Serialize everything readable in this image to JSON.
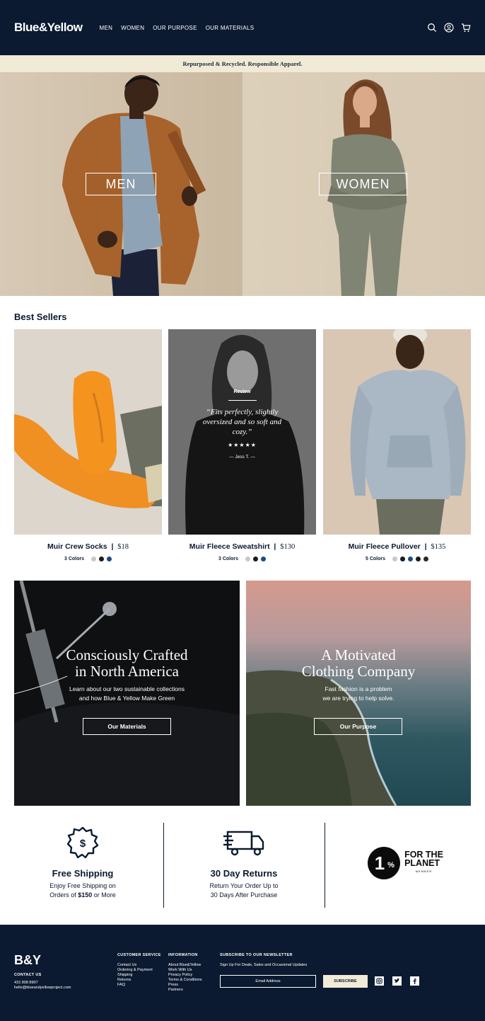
{
  "header": {
    "logo": "Blue&Yellow",
    "nav": [
      "MEN",
      "WOMEN",
      "OUR PURPOSE",
      "OUR MATERIALS"
    ],
    "icons": [
      "search-icon",
      "account-icon",
      "cart-icon"
    ]
  },
  "banner": {
    "text": "Repurposed & Recycled. Responsible Apparel."
  },
  "hero": {
    "men_label": "MEN",
    "women_label": "WOMEN"
  },
  "best_sellers": {
    "title": "Best Sellers",
    "review": {
      "label": "Review",
      "quote": "“Fits perfectly, slightly oversized and so soft and cozy.”",
      "stars": "★★★★★",
      "author": "— Jess T. —"
    },
    "products": [
      {
        "name": "Muir Crew Socks",
        "price": "$18",
        "colors_label": "3 Colors",
        "swatches": [
          "#c8c8c8",
          "#1b1b1b",
          "#1e4a86"
        ]
      },
      {
        "name": "Muir Fleece Sweatshirt",
        "price": "$130",
        "colors_label": "3 Colors",
        "swatches": [
          "#c8c8c8",
          "#1b1b1b",
          "#1e4a86"
        ]
      },
      {
        "name": "Muir Fleece Pullover",
        "price": "$135",
        "colors_label": "5 Colors",
        "swatches": [
          "#c8c8c8",
          "#1b1b1b",
          "#1e4a86",
          "#1b1b1b",
          "#2a2a2a"
        ]
      }
    ]
  },
  "features": [
    {
      "title_line1": "Consciously Crafted",
      "title_line2": "in North America",
      "sub_line1": "Learn about our two sustainable collections",
      "sub_line2": "and how Blue & Yellow Make Green",
      "button": "Our Materials"
    },
    {
      "title_line1": "A Motivated",
      "title_line2": "Clothing Company",
      "sub_line1": "Fast fashion is a problem",
      "sub_line2": "we are trying to help solve.",
      "button": "Our Purpose"
    }
  ],
  "value_props": [
    {
      "icon": "dollar-badge-icon",
      "title": "Free Shipping",
      "line1_pre": "Enjoy Free Shipping on",
      "line2_pre": "Orders of ",
      "line2_bold": "$150",
      "line2_post": " or More"
    },
    {
      "icon": "truck-icon",
      "title": "30 Day Returns",
      "line1_pre": "Return Your Order Up to",
      "line2_pre": "30 Days After Purchase",
      "line2_bold": "",
      "line2_post": ""
    },
    {
      "icon": "one-percent-planet-logo",
      "brand_line1": "FOR THE",
      "brand_line2": "PLANET",
      "brand_sub": "MEMBER",
      "brand_mark": "1"
    }
  ],
  "footer": {
    "logo": "B&Y",
    "contact_title": "CONTACT US",
    "phone": "415 808 8907",
    "email": "hello@blueandyellowproject.com",
    "customer_service": {
      "title": "CUSTOMER SERVICE",
      "links": [
        "Contact Us",
        "Ordering & Payment",
        "Shipping",
        "Returns",
        "FAQ"
      ]
    },
    "information": {
      "title": "INFORMATION",
      "links": [
        "About Blue&Yellow",
        "Work With Us",
        "Privacy Policy",
        "Terms & Conditions",
        "Press",
        "Partners"
      ]
    },
    "newsletter": {
      "title": "SUBSCRIBE TO OUR NEWSLETTER",
      "subtitle": "Sign Up For Deals, Sales and Occasional Updates",
      "placeholder": "Email Address",
      "button": "SUBSCRIBE"
    },
    "social": [
      "instagram-icon",
      "twitter-icon",
      "facebook-icon"
    ]
  }
}
